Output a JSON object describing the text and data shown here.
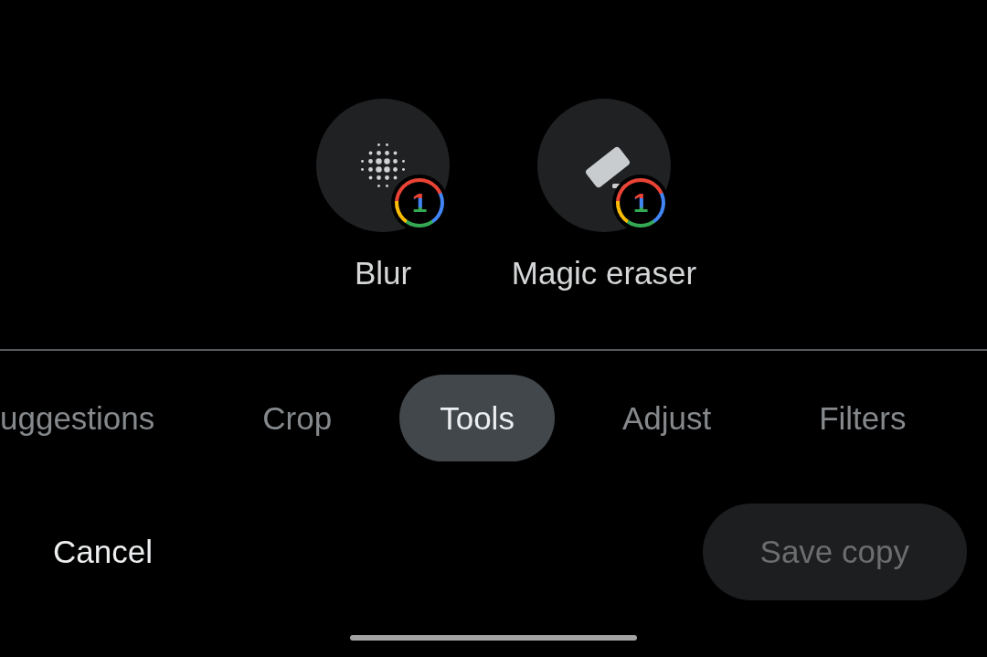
{
  "tools": [
    {
      "label": "Blur",
      "kind": "blur",
      "badge": "1"
    },
    {
      "label": "Magic eraser",
      "kind": "eraser",
      "badge": "1"
    }
  ],
  "tabs": [
    {
      "label": "uggestions",
      "selected": false
    },
    {
      "label": "Crop",
      "selected": false
    },
    {
      "label": "Tools",
      "selected": true
    },
    {
      "label": "Adjust",
      "selected": false
    },
    {
      "label": "Filters",
      "selected": false
    }
  ],
  "actions": {
    "cancel": "Cancel",
    "save": {
      "label": "Save copy",
      "disabled": true
    }
  }
}
